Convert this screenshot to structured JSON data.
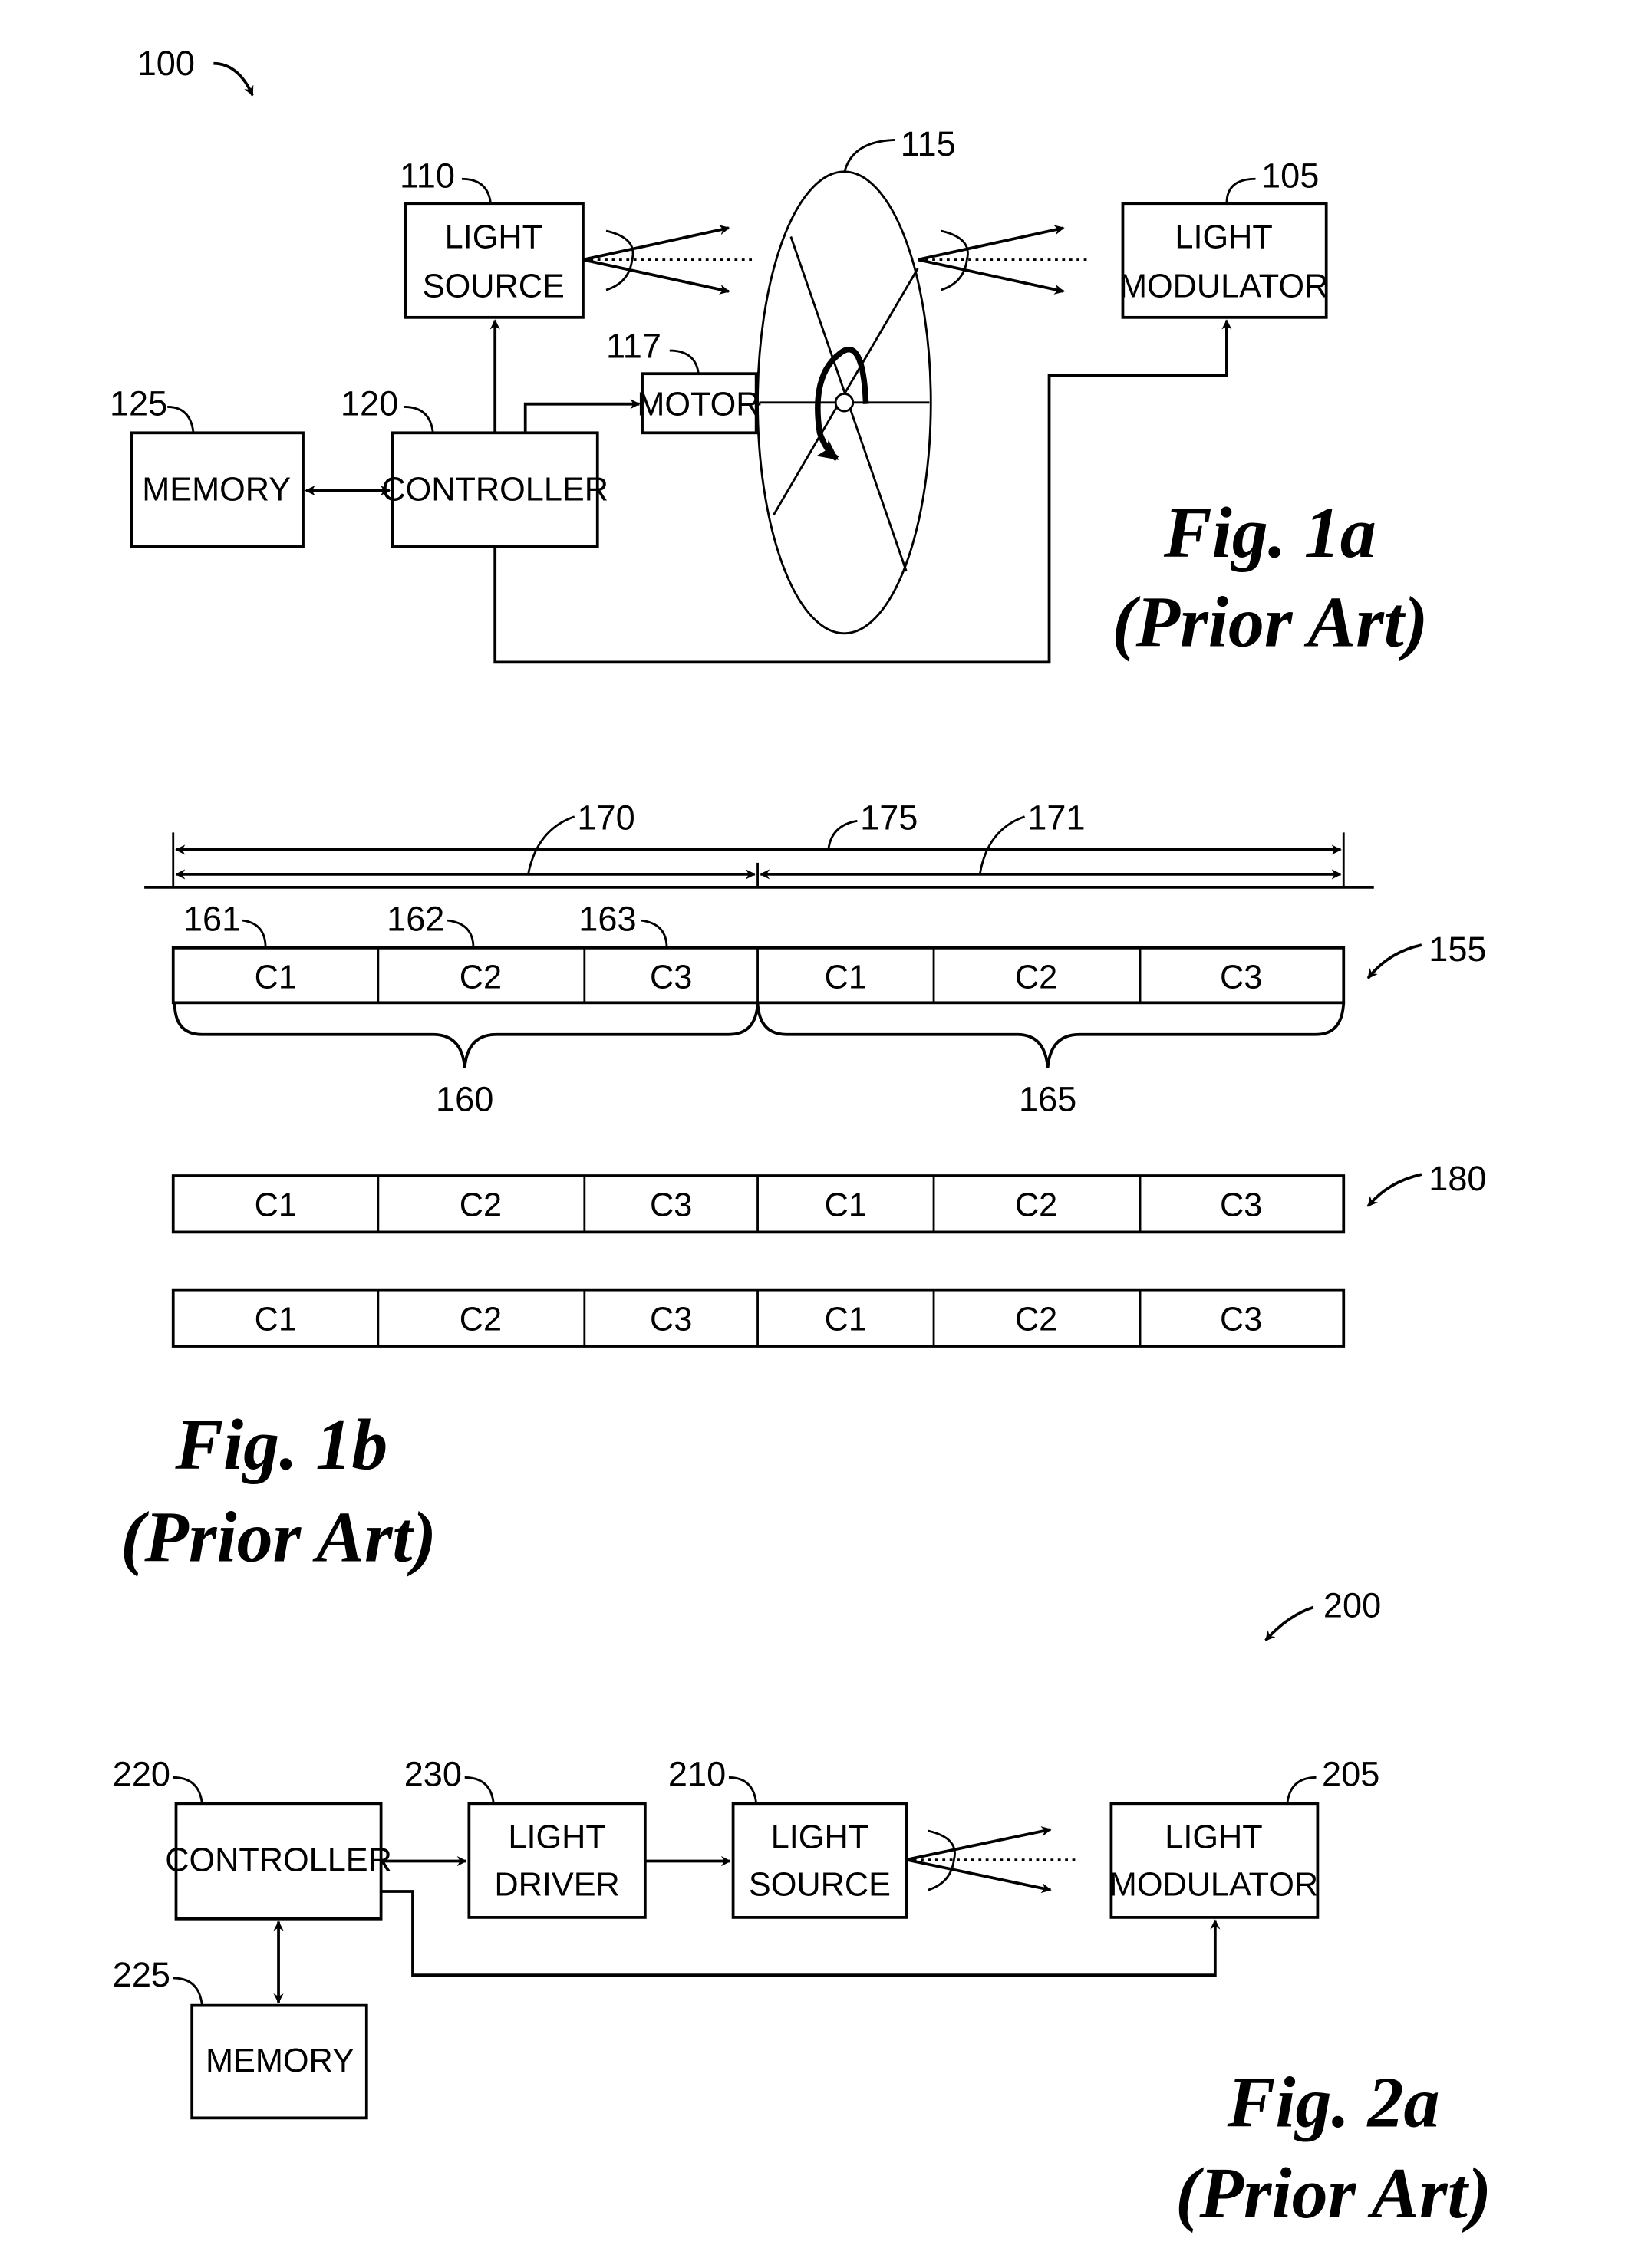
{
  "figure_1a": {
    "ref": "100",
    "caption": "Fig. 1a",
    "subcaption": "(Prior Art)",
    "blocks": {
      "light_source": {
        "ref": "110",
        "line1": "LIGHT",
        "line2": "SOURCE"
      },
      "color_wheel": {
        "ref": "115"
      },
      "light_modulator": {
        "ref": "105",
        "line1": "LIGHT",
        "line2": "MODULATOR"
      },
      "motor": {
        "ref": "117",
        "label": "MOTOR"
      },
      "controller": {
        "ref": "120",
        "label": "CONTROLLER"
      },
      "memory": {
        "ref": "125",
        "label": "MEMORY"
      }
    }
  },
  "figure_1b": {
    "caption": "Fig. 1b",
    "subcaption": "(Prior Art)",
    "spans": {
      "first_half": "170",
      "full": "175",
      "second_half": "171"
    },
    "segment_refs": [
      "161",
      "162",
      "163"
    ],
    "group_refs": [
      "160",
      "165"
    ],
    "row_refs": [
      "155",
      "180"
    ],
    "rows": [
      [
        "C1",
        "C2",
        "C3",
        "C1",
        "C2",
        "C3"
      ],
      [
        "C1",
        "C2",
        "C3",
        "C1",
        "C2",
        "C3"
      ],
      [
        "C1",
        "C2",
        "C3",
        "C1",
        "C2",
        "C3"
      ]
    ]
  },
  "figure_2a": {
    "ref": "200",
    "caption": "Fig. 2a",
    "subcaption": "(Prior Art)",
    "blocks": {
      "controller": {
        "ref": "220",
        "label": "CONTROLLER"
      },
      "light_driver": {
        "ref": "230",
        "line1": "LIGHT",
        "line2": "DRIVER"
      },
      "light_source": {
        "ref": "210",
        "line1": "LIGHT",
        "line2": "SOURCE"
      },
      "light_modulator": {
        "ref": "205",
        "line1": "LIGHT",
        "line2": "MODULATOR"
      },
      "memory": {
        "ref": "225",
        "label": "MEMORY"
      }
    }
  }
}
